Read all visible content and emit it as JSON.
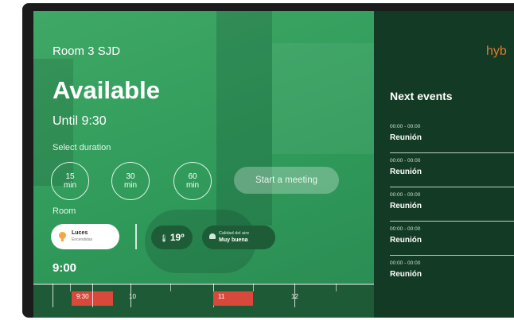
{
  "room": {
    "name": "Room 3 SJD",
    "status": "Available",
    "until": "Until 9:30",
    "select_duration_label": "Select duration",
    "durations": [
      {
        "value": "15",
        "unit": "min"
      },
      {
        "value": "30",
        "unit": "min"
      },
      {
        "value": "60",
        "unit": "min"
      }
    ],
    "start_button": "Start a meeting",
    "room_section_label": "Room",
    "lights": {
      "title": "Luces",
      "subtitle": "Encendidas"
    },
    "temperature": "19º",
    "air_quality": {
      "label": "Calidad del aire",
      "value": "Muy buena"
    },
    "current_time": "9:00"
  },
  "timeline": {
    "blocks": [
      {
        "label": "9:30",
        "color": "#d9493b"
      },
      {
        "label": "11",
        "color": "#d9493b"
      }
    ],
    "hours": [
      "10",
      "12"
    ]
  },
  "sidebar": {
    "brand": "hyb",
    "next_events_title": "Next events",
    "events": [
      {
        "time": "00:00 - 00:00",
        "title": "Reunión"
      },
      {
        "time": "00:00 - 00:00",
        "title": "Reunión"
      },
      {
        "time": "00:00 - 00:00",
        "title": "Reunión"
      },
      {
        "time": "00:00 - 00:00",
        "title": "Reunión"
      },
      {
        "time": "00:00 - 00:00",
        "title": "Reunión"
      }
    ]
  },
  "colors": {
    "available_green": "#3fa866",
    "panel_dark": "#133a24",
    "brand_orange": "#e07a2e",
    "booking_red": "#d9493b"
  }
}
